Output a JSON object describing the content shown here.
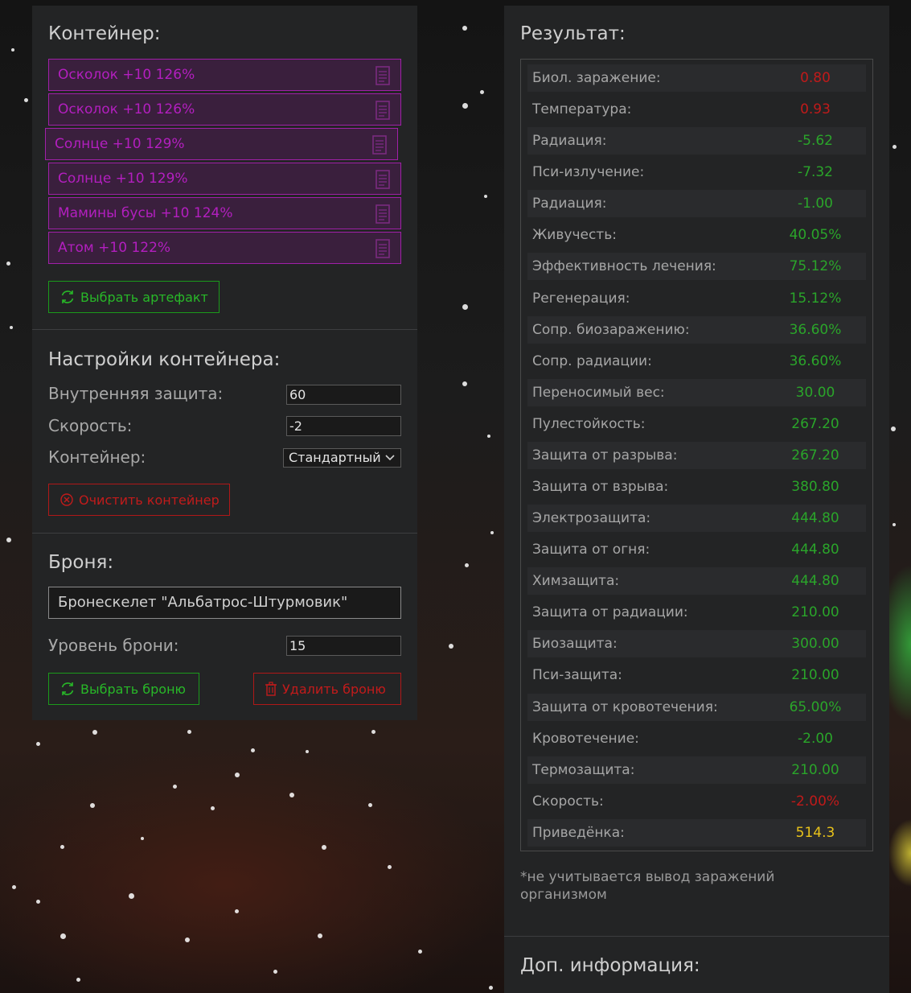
{
  "left": {
    "container_title": "Контейнер:",
    "artifacts": [
      {
        "label": "Осколок +10 126%"
      },
      {
        "label": "Осколок +10 126%"
      },
      {
        "label": "Солнце +10 129%"
      },
      {
        "label": "Солнце +10 129%"
      },
      {
        "label": "Мамины бусы +10 124%"
      },
      {
        "label": "Атом +10 122%"
      }
    ],
    "choose_artifact": "Выбрать артефакт",
    "settings_title": "Настройки контейнера:",
    "internal_protection_label": "Внутренняя защита:",
    "internal_protection_value": "60",
    "speed_label": "Скорость:",
    "speed_value": "-2",
    "container_label": "Контейнер:",
    "container_value": "Стандартный",
    "clear_container": "Очистить контейнер",
    "armor_title": "Броня:",
    "armor_name": "Бронескелет \"Альбатрос-Штурмовик\"",
    "armor_level_label": "Уровень брони:",
    "armor_level_value": "15",
    "choose_armor": "Выбрать броню",
    "delete_armor": "Удалить броню"
  },
  "right": {
    "result_title": "Результат:",
    "stats": [
      {
        "name": "Биол. заражение:",
        "value": "0.80",
        "color": "#c01a1a"
      },
      {
        "name": "Температура:",
        "value": "0.93",
        "color": "#c01a1a"
      },
      {
        "name": "Радиация:",
        "value": "-5.62",
        "color": "#2aa52a"
      },
      {
        "name": "Пси-излучение:",
        "value": "-7.32",
        "color": "#2aa52a"
      },
      {
        "name": "Радиация:",
        "value": "-1.00",
        "color": "#2aa52a"
      },
      {
        "name": "Живучесть:",
        "value": "40.05%",
        "color": "#2aa52a"
      },
      {
        "name": "Эффективность лечения:",
        "value": "75.12%",
        "color": "#2aa52a"
      },
      {
        "name": "Регенерация:",
        "value": "15.12%",
        "color": "#2aa52a"
      },
      {
        "name": "Сопр. биозаражению:",
        "value": "36.60%",
        "color": "#2aa52a"
      },
      {
        "name": "Сопр. радиации:",
        "value": "36.60%",
        "color": "#2aa52a"
      },
      {
        "name": "Переносимый вес:",
        "value": "30.00",
        "color": "#2aa52a"
      },
      {
        "name": "Пулестойкость:",
        "value": "267.20",
        "color": "#2aa52a"
      },
      {
        "name": "Защита от разрыва:",
        "value": "267.20",
        "color": "#2aa52a"
      },
      {
        "name": "Защита от взрыва:",
        "value": "380.80",
        "color": "#2aa52a"
      },
      {
        "name": "Электрозащита:",
        "value": "444.80",
        "color": "#2aa52a"
      },
      {
        "name": "Защита от огня:",
        "value": "444.80",
        "color": "#2aa52a"
      },
      {
        "name": "Химзащита:",
        "value": "444.80",
        "color": "#2aa52a"
      },
      {
        "name": "Защита от радиации:",
        "value": "210.00",
        "color": "#2aa52a"
      },
      {
        "name": "Биозащита:",
        "value": "300.00",
        "color": "#2aa52a"
      },
      {
        "name": "Пси-защита:",
        "value": "210.00",
        "color": "#2aa52a"
      },
      {
        "name": "Защита от кровотечения:",
        "value": "65.00%",
        "color": "#2aa52a"
      },
      {
        "name": "Кровотечение:",
        "value": "-2.00",
        "color": "#2aa52a"
      },
      {
        "name": "Термозащита:",
        "value": "210.00",
        "color": "#2aa52a"
      },
      {
        "name": "Скорость:",
        "value": "-2.00%",
        "color": "#c01a1a"
      },
      {
        "name": "Приведёнка:",
        "value": "514.3",
        "color": "#e8c21a"
      }
    ],
    "footnote": "*не учитывается вывод заражений организмом",
    "extra_title": "Доп. информация:"
  }
}
